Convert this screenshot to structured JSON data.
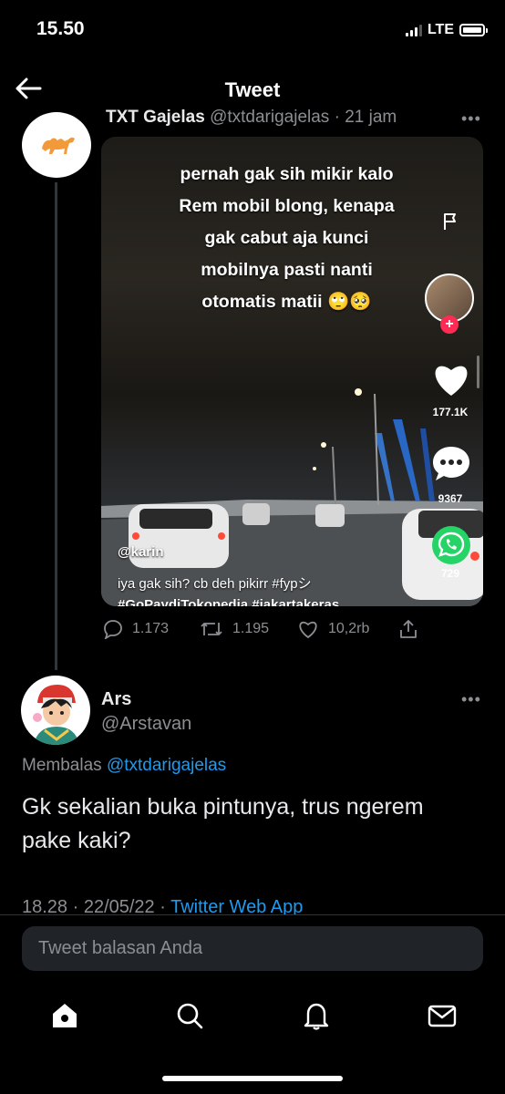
{
  "status": {
    "time": "15.50",
    "network": "LTE"
  },
  "header": {
    "title": "Tweet"
  },
  "quoted": {
    "name": "TXT Gajelas",
    "handle": "@txtdarigajelas",
    "time": "· 21 jam",
    "media": {
      "caption_lines": [
        "pernah gak sih mikir kalo",
        "Rem mobil blong, kenapa",
        "gak cabut aja kunci",
        "mobilnya pasti nanti",
        "otomatis matii 🙄🥺"
      ],
      "user": "@karin",
      "desc": "iya gak sih? cb deh pikirr #fypシ",
      "desc2": "#GoPaydiTokopedia #jakartakeras",
      "likes": "177.1K",
      "comments": "9367",
      "shares": "729"
    },
    "actions": {
      "replies": "1.173",
      "retweets": "1.195",
      "likes": "10,2rb"
    }
  },
  "reply": {
    "name": "Ars",
    "handle": "@Arstavan",
    "replying_label": "Membalas",
    "replying_to": "@txtdarigajelas",
    "text": "Gk sekalian buka pintunya, trus ngerem pake kaki?",
    "timestamp": "18.28 · 22/05/22 · ",
    "source": "Twitter Web App"
  },
  "compose": {
    "placeholder": "Tweet balasan Anda"
  },
  "nav": [
    "home-icon",
    "search-icon",
    "bell-icon",
    "mail-icon"
  ],
  "colors": {
    "accent": "#1d9bf0",
    "muted": "#8b8f93",
    "background": "#000000"
  }
}
